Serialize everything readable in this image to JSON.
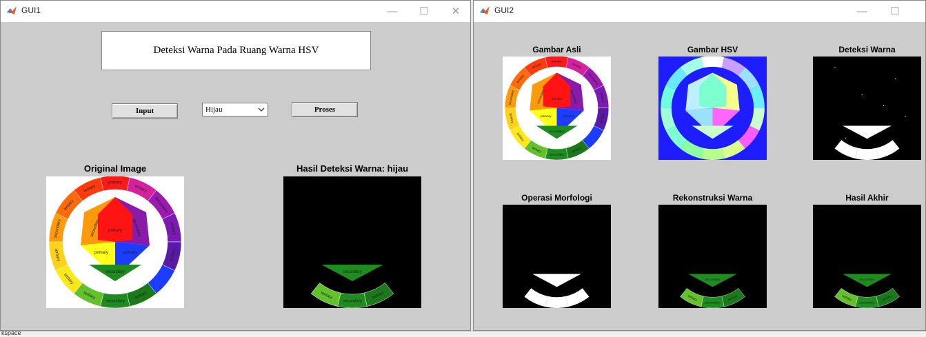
{
  "gui1": {
    "title": "GUI1",
    "header_text": "Deteksi Warna Pada Ruang Warna HSV",
    "input_button": "Input",
    "color_select": {
      "value": "Hijau"
    },
    "process_button": "Proses",
    "axes": [
      {
        "title": "Original Image"
      },
      {
        "title": "Hasil Deteksi Warna: hijau"
      }
    ]
  },
  "gui2": {
    "title": "GUI2",
    "axes": [
      {
        "title": "Gambar Asli"
      },
      {
        "title": "Gambar HSV"
      },
      {
        "title": "Deteksi Warna"
      },
      {
        "title": "Operasi Morfologi"
      },
      {
        "title": "Rekonstruksi Warna"
      },
      {
        "title": "Hasil Akhir"
      }
    ]
  },
  "window_controls": {
    "minimize": "—",
    "maximize": "☐",
    "close": "✕"
  },
  "wheel_labels": {
    "primary": "primary",
    "secondary": "secondary",
    "tertiary": "tertiary"
  },
  "taskbar_text": "kspace",
  "colors": {
    "client_bg": "#cccccc",
    "green_outer": "#1e8c1e",
    "green_light": "#63c12b",
    "green_dark": "#1a7a1a",
    "red": "#ff1414",
    "blue": "#1c3dff",
    "yellow": "#ffff1a",
    "orange": "#ff9a0d",
    "purple": "#8a1aa8",
    "hsv_bg": "#1d1dff"
  }
}
